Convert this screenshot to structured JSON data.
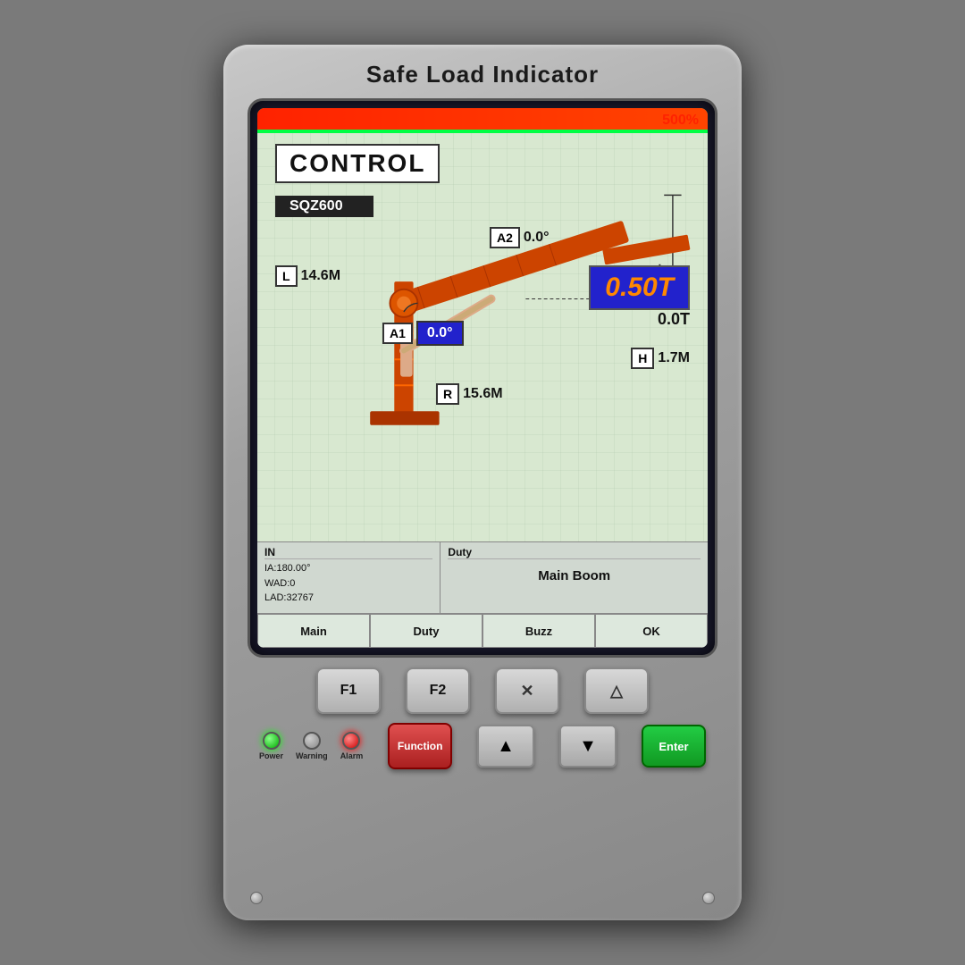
{
  "device": {
    "title": "Safe Load Indicator"
  },
  "screen": {
    "load_percent": "500%",
    "control_label": "CONTROL",
    "model": "SQZ600",
    "L_label": "L",
    "L_value": "14.6M",
    "A2_label": "A2",
    "A2_value": "0.0°",
    "A1_label": "A1",
    "A1_value": "0.0°",
    "safe_load": "0.50T",
    "actual_load": "0.0T",
    "H_label": "H",
    "H_value": "1.7M",
    "R_label": "R",
    "R_value": "15.6M",
    "info": {
      "in_label": "IN",
      "ia": "IA:180.00°",
      "wad": "WAD:0",
      "lad": "LAD:32767",
      "duty_label": "Duty",
      "duty_value": "Main Boom"
    },
    "buttons": {
      "main": "Main",
      "duty": "Duty",
      "buzz": "Buzz",
      "ok": "OK"
    }
  },
  "physical": {
    "f1": "F1",
    "f2": "F2",
    "f3_icon": "✕",
    "f4_icon": "△",
    "function": "Function",
    "up_icon": "▲",
    "down_icon": "▼",
    "enter": "Enter",
    "power_label": "Power",
    "warning_label": "Warning",
    "alarm_label": "Alarm"
  }
}
